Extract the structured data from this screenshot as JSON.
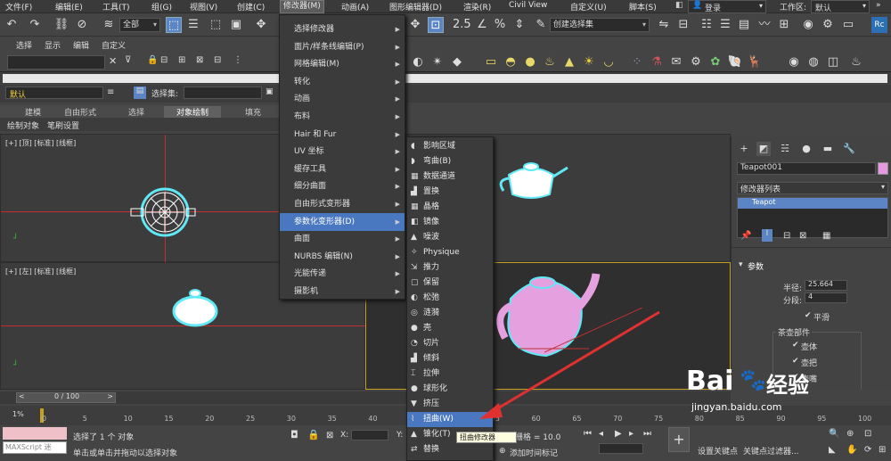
{
  "menubar": {
    "file": "文件(F)",
    "edit": "编辑(E)",
    "tools": "工具(T)",
    "group": "组(G)",
    "views": "视图(V)",
    "create": "创建(C)",
    "modifiers": "修改器(M)",
    "animation": "动画(A)",
    "graph": "图形编辑器(D)",
    "render": "渲染(R)",
    "civil": "Civil View",
    "customize": "自定义(U)",
    "script": "脚本(S)",
    "login": "登录",
    "workspace_label": "工作区:",
    "workspace_value": "默认"
  },
  "toolbar": {
    "filter_value": "全部",
    "selection_set_value": "创建选择集",
    "coord_system": "视图"
  },
  "scene_explorer": {
    "select": "选择",
    "display": "显示",
    "edit": "编辑",
    "customize": "自定义"
  },
  "layer": {
    "default": "默认",
    "select_set_label": "选择集:"
  },
  "ribbon_tabs": {
    "build": "建模",
    "freeform": "自由形式",
    "selection": "选择",
    "object_paint": "对象绘制",
    "populate": "填充"
  },
  "sub_tabs": {
    "paint_object": "绘制对象",
    "brush_settings": "笔刷设置"
  },
  "viewports": {
    "top_label": "[+] [顶] [标准] [线框]",
    "left_label": "[+] [左] [标准] [线框]"
  },
  "modifiers_menu": {
    "items": [
      "选择修改器",
      "面片/样条线编辑(P)",
      "网格编辑(M)",
      "转化",
      "动画",
      "布料",
      "Hair 和 Fur",
      "UV 坐标",
      "缓存工具",
      "细分曲面",
      "自由形式变形器",
      "参数化变形器(D)",
      "曲面",
      "NURBS 编辑(N)",
      "光能传递",
      "摄影机"
    ],
    "selected": "参数化变形器(D)"
  },
  "param_submenu": {
    "items": [
      "影响区域",
      "弯曲(B)",
      "数据通道",
      "置换",
      "晶格",
      "镜像",
      "噪波",
      "Physique",
      "推力",
      "保留",
      "松弛",
      "涟漪",
      "壳",
      "切片",
      "倾斜",
      "拉伸",
      "球形化",
      "挤压",
      "扭曲(W)",
      "锥化(T)",
      "替换"
    ],
    "selected": "扭曲(W)",
    "tooltip": "扭曲修改器"
  },
  "command_panel": {
    "object_name": "Teapot001",
    "modifier_list": "修改器列表",
    "stack_item": "Teapot",
    "params_title": "参数",
    "radius_label": "半径:",
    "radius_value": "25.664",
    "segments_label": "分段:",
    "segments_value": "4",
    "smooth_label": "平滑",
    "parts_label": "茶壶部件",
    "body_label": "壶体",
    "handle_label": "壶把",
    "spout_label": "壶嘴",
    "object_color": "#e599e0"
  },
  "timeline": {
    "frame_display": "0 / 100",
    "ticks": [
      "0",
      "5",
      "10",
      "15",
      "20",
      "25",
      "30",
      "35",
      "40",
      "45",
      "50",
      "55",
      "60",
      "65",
      "70",
      "75",
      "80",
      "85",
      "90",
      "95",
      "100"
    ],
    "percent": "1%"
  },
  "status": {
    "maxscript": "MAXScript 迷",
    "selected_text": "选择了 1 个 对象",
    "hint_text": "单击或单击并拖动以选择对象",
    "x_label": "X:",
    "y_label": "Y:",
    "grid_label": "栅格 = 10.0",
    "add_time_tag": "添加时间标记",
    "set_key": "设置关键点",
    "key_filter": "关键点过滤器..."
  },
  "watermark": "jingyan.baidu.com",
  "colors": {
    "menu_highlight": "#4a78c0",
    "teapot": "#e5a0e0",
    "arrow": "#e03030",
    "viewport_border": "#c8a020"
  }
}
